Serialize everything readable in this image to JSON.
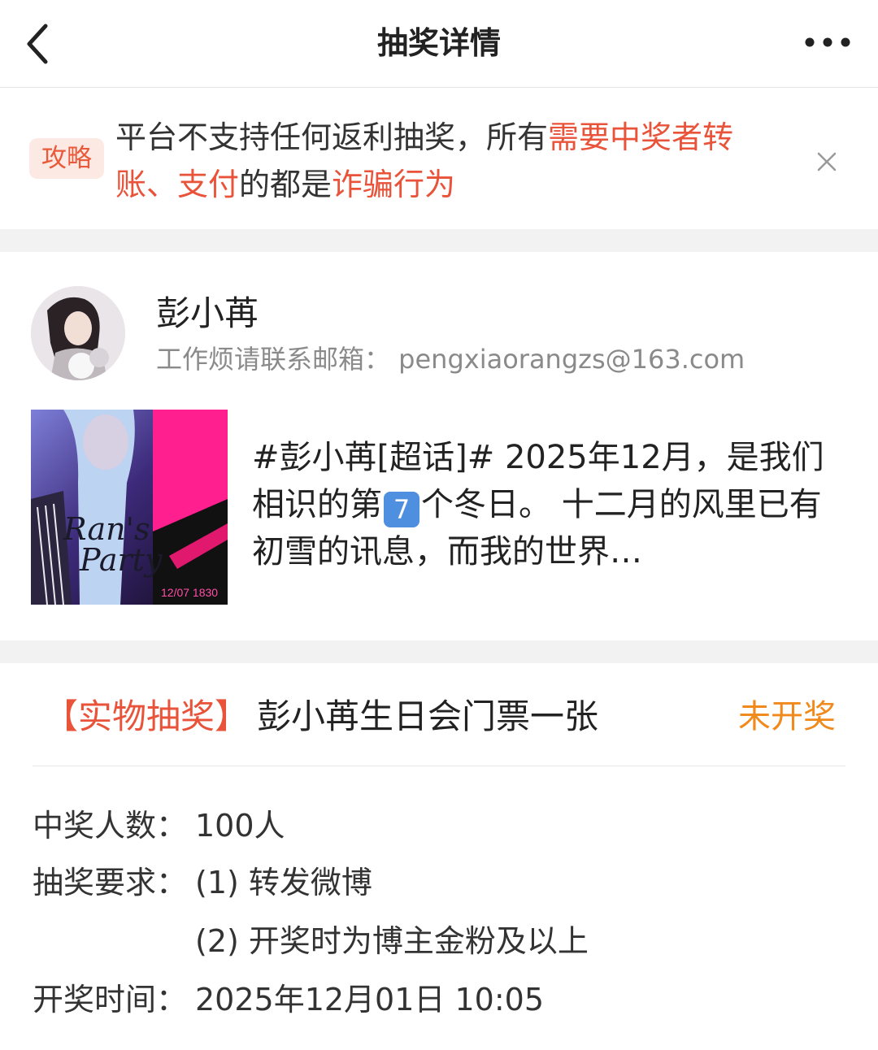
{
  "header": {
    "title": "抽奖详情"
  },
  "notice": {
    "tag": "攻略",
    "part1": "平台不支持任何返利抽奖，所有",
    "highlight1": "需要中奖者转账、支付",
    "part2": "的都是",
    "highlight2": "诈骗行为"
  },
  "post": {
    "user_name": "彭小苒",
    "user_desc": "工作烦请联系邮箱： pengxiaorangzs@163.com",
    "cover": {
      "title_line1": "Ran's",
      "title_line2": "Party",
      "date_text": "12/07 1830"
    },
    "text_before": "#彭小苒[超话]# 2025年12月，是我们相识的第",
    "keycap": "7",
    "text_after": "个冬日。 十二月的风里已有初雪的讯息，而我的世界…"
  },
  "lottery": {
    "type_label": "【实物抽奖】",
    "title": "彭小苒生日会门票一张",
    "status": "未开奖",
    "winners_label": "中奖人数：",
    "winners_value": "100人",
    "requirements_label": "抽奖要求：",
    "requirement_1": "(1) 转发微博",
    "requirement_2": "(2) 开奖时为博主金粉及以上",
    "time_label": "开奖时间：",
    "time_value": "2025年12月01日 10:05"
  },
  "colors": {
    "accent_red": "#e8533a",
    "status_orange": "#f08a1c",
    "tag_bg": "#fde9e4"
  }
}
